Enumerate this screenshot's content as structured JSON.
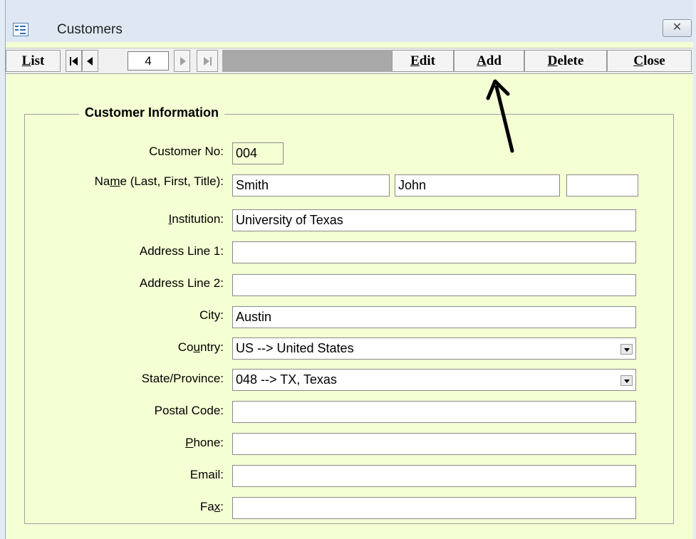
{
  "window": {
    "title": "Customers",
    "close_icon": "close-icon"
  },
  "toolbar": {
    "list": {
      "accel": "L",
      "rest": "ist"
    },
    "edit": {
      "accel": "E",
      "rest": "dit"
    },
    "add": {
      "accel": "A",
      "rest": "dd"
    },
    "delete": {
      "accel": "D",
      "rest": "elete"
    },
    "close": {
      "accel": "C",
      "rest": "lose"
    },
    "record_number": "4",
    "nav_first": "⏮",
    "nav_prev": "◀",
    "nav_next": "▶",
    "nav_last": "⏭"
  },
  "form": {
    "group_title": "Customer Information",
    "customer_no": {
      "label": "Customer No:",
      "value": "004"
    },
    "name": {
      "label_pre": "Na",
      "label_accel": "m",
      "label_post": "e (Last, First, Title):",
      "last": "Smith",
      "first": "John",
      "title": ""
    },
    "institution": {
      "label_accel": "I",
      "label_post": "nstitution:",
      "value": "University of Texas"
    },
    "address1": {
      "label": "Address Line 1:",
      "value": ""
    },
    "address2": {
      "label": "Address Line 2:",
      "value": ""
    },
    "city": {
      "label": "City:",
      "value": "Austin"
    },
    "country": {
      "label_pre": "Co",
      "label_accel": "u",
      "label_post": "ntry:",
      "value": "US --> United States"
    },
    "state": {
      "label": "State/Province:",
      "value": "048 --> TX, Texas"
    },
    "postal": {
      "label": "Postal Code:",
      "value": ""
    },
    "phone": {
      "label_accel": "P",
      "label_post": "hone:",
      "value": ""
    },
    "email": {
      "label": "Email:",
      "value": ""
    },
    "fax": {
      "label_pre": "Fa",
      "label_accel": "x",
      "label_post": ":",
      "value": ""
    }
  }
}
